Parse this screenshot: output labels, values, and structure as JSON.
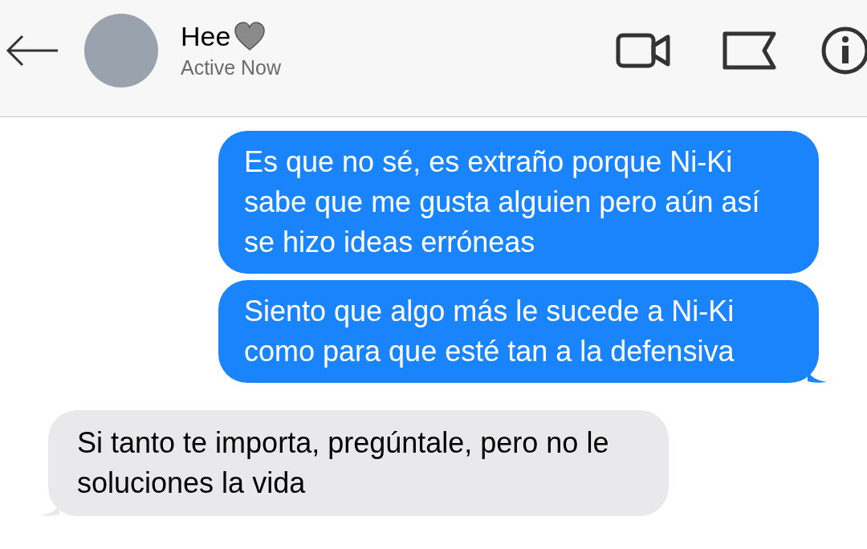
{
  "header": {
    "name": "Hee",
    "status": "Active Now"
  },
  "messages": [
    {
      "kind": "sent",
      "text": "Es que no sé, es extraño porque Ni-Ki sabe que me gusta alguien pero aún así se hizo ideas erróneas",
      "tail": false
    },
    {
      "kind": "sent",
      "text": "Siento que algo más le sucede a Ni-Ki como para que esté tan a la defensiva",
      "tail": true
    },
    {
      "kind": "received",
      "text": "Si tanto te importa, pregúntale, pero no le soluciones la vida",
      "tail": true
    }
  ]
}
